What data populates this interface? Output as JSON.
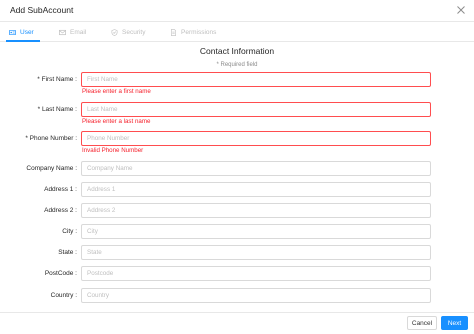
{
  "dialog": {
    "title": "Add SubAccount"
  },
  "tabs": [
    {
      "label": "User",
      "icon": "id-card-icon",
      "active": true
    },
    {
      "label": "Email",
      "icon": "mail-icon",
      "active": false
    },
    {
      "label": "Security",
      "icon": "shield-check-icon",
      "active": false
    },
    {
      "label": "Permissions",
      "icon": "document-icon",
      "active": false
    }
  ],
  "form": {
    "section_title": "Contact Information",
    "required_note": "* Required field",
    "fields": [
      {
        "label": "* First Name :",
        "placeholder": "First Name",
        "value": "",
        "error": "Please enter a first name"
      },
      {
        "label": "* Last Name :",
        "placeholder": "Last Name",
        "value": "",
        "error": "Please enter a last name"
      },
      {
        "label": "* Phone Number :",
        "placeholder": "Phone Number",
        "value": "",
        "error": "Invalid Phone Number"
      },
      {
        "label": "Company Name :",
        "placeholder": "Company Name",
        "value": ""
      },
      {
        "label": "Address 1 :",
        "placeholder": "Address 1",
        "value": ""
      },
      {
        "label": "Address 2 :",
        "placeholder": "Address 2",
        "value": ""
      },
      {
        "label": "City :",
        "placeholder": "City",
        "value": ""
      },
      {
        "label": "State :",
        "placeholder": "State",
        "value": ""
      },
      {
        "label": "PostCode :",
        "placeholder": "Postcode",
        "value": ""
      },
      {
        "label": "Country :",
        "placeholder": "Country",
        "value": ""
      }
    ]
  },
  "footer": {
    "cancel_label": "Cancel",
    "next_label": "Next"
  },
  "colors": {
    "primary": "#1890ff",
    "error": "#f5222d",
    "border": "#d9d9d9",
    "muted": "#bfbfbf"
  }
}
